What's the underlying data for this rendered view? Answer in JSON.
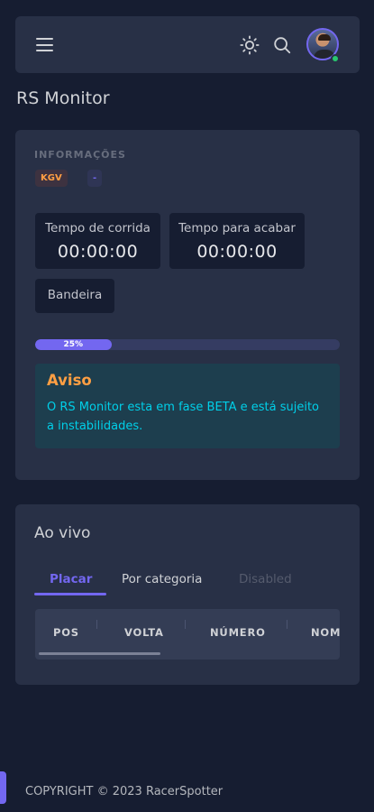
{
  "navbar": {
    "icons": [
      "menu-icon",
      "sun-icon",
      "search-icon"
    ],
    "user_status_color": "#28c76f"
  },
  "page_title": "RS Monitor",
  "info": {
    "section_label": "INFORMAÇÕES",
    "badges": [
      "KGV",
      "-"
    ],
    "race_time_label": "Tempo de corrida",
    "race_time_value": "00:00:00",
    "remaining_time_label": "Tempo para acabar",
    "remaining_time_value": "00:00:00",
    "flag_label": "Bandeira",
    "progress_percent": 25,
    "progress_text": "25%",
    "alert_title": "Aviso",
    "alert_body": "O RS Monitor esta em fase BETA e está sujeito a instabilidades."
  },
  "live": {
    "title": "Ao vivo",
    "tabs": [
      "Placar",
      "Por categoria",
      "Disabled"
    ],
    "active_tab": "Placar",
    "columns": [
      "POS",
      "VOLTA",
      "NÚMERO",
      "NOM"
    ]
  },
  "footer": {
    "copyright": "COPYRIGHT © 2023 RacerSpotter"
  },
  "colors": {
    "accent": "#7367f0",
    "warning": "#ff9f43",
    "info": "#00cfe8",
    "background": "#161d31",
    "card": "#283046"
  }
}
